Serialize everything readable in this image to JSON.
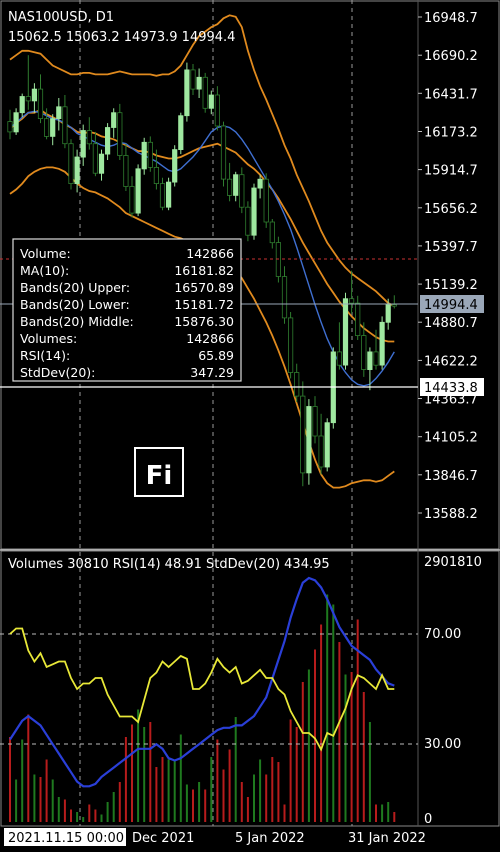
{
  "header": {
    "symbol": "NAS100USD, D1",
    "ohlc": "15062.5 15063.2 14973.9 14994.4"
  },
  "price_axis": {
    "labels": [
      "16948.7",
      "16690.2",
      "16431.7",
      "16173.2",
      "15914.7",
      "15656.2",
      "15397.7",
      "15139.2",
      "14880.7",
      "14622.2",
      "14363.7",
      "14105.2",
      "13846.7",
      "13588.2"
    ],
    "current_price": "14994.4",
    "crosshair_price": "14433.8"
  },
  "data_window": {
    "rows": [
      {
        "label": "Volume:",
        "value": "142866"
      },
      {
        "label": "MA(10):",
        "value": "16181.82"
      },
      {
        "label": "Bands(20) Upper:",
        "value": "16570.89"
      },
      {
        "label": "Bands(20) Lower:",
        "value": "15181.72"
      },
      {
        "label": "Bands(20) Middle:",
        "value": "15876.30"
      },
      {
        "label": "Volumes:",
        "value": "142866"
      },
      {
        "label": "RSI(14):",
        "value": "65.89"
      },
      {
        "label": "StdDev(20):",
        "value": "347.29"
      }
    ]
  },
  "logo": {
    "text": "Fi"
  },
  "subwindow": {
    "title": "Volumes 30810 RSI(14) 48.91 StdDev(20) 434.95",
    "labels": [
      "2901810",
      "70.00",
      "30.00",
      "0"
    ]
  },
  "time_axis": {
    "labels": [
      "2021.11.15 00:00",
      "Dec 2021",
      "5 Jan 2022",
      "31 Jan 2022"
    ]
  },
  "colors": {
    "bull_candle": "#9fe8a0",
    "bear_candle": "#2f7d2f",
    "bands": "#e08a1e",
    "ma": "#3f6fd1",
    "rsi": "#e8e838",
    "stddev": "#2a3fd8",
    "vol_up": "#1f7a1f",
    "vol_down": "#b81c1c",
    "red_level": "#c83232"
  },
  "chart_data": {
    "type": "candlestick",
    "ohlc": [
      [
        16240,
        16320,
        16120,
        16170
      ],
      [
        16170,
        16330,
        16150,
        16300
      ],
      [
        16300,
        16430,
        16270,
        16410
      ],
      [
        16410,
        16690,
        16320,
        16380
      ],
      [
        16380,
        16500,
        16300,
        16460
      ],
      [
        16460,
        16560,
        16230,
        16260
      ],
      [
        16260,
        16330,
        16120,
        16140
      ],
      [
        16140,
        16290,
        16080,
        16260
      ],
      [
        16260,
        16400,
        16180,
        16340
      ],
      [
        16340,
        16420,
        16060,
        16090
      ],
      [
        16090,
        16120,
        15780,
        15820
      ],
      [
        15820,
        16050,
        15760,
        16000
      ],
      [
        16000,
        16220,
        15940,
        16180
      ],
      [
        16180,
        16270,
        16050,
        16090
      ],
      [
        16090,
        16170,
        15870,
        15890
      ],
      [
        15890,
        16050,
        15840,
        16020
      ],
      [
        16020,
        16230,
        15980,
        16200
      ],
      [
        16200,
        16330,
        16130,
        16300
      ],
      [
        16300,
        16360,
        15980,
        16010
      ],
      [
        16010,
        16090,
        15770,
        15800
      ],
      [
        15800,
        15870,
        15590,
        15620
      ],
      [
        15620,
        15950,
        15600,
        15920
      ],
      [
        15920,
        16130,
        15880,
        16100
      ],
      [
        16100,
        16140,
        15900,
        15930
      ],
      [
        15930,
        16050,
        15780,
        15820
      ],
      [
        15820,
        15860,
        15640,
        15660
      ],
      [
        15660,
        15860,
        15640,
        15830
      ],
      [
        15830,
        16080,
        15800,
        16050
      ],
      [
        16050,
        16300,
        16020,
        16280
      ],
      [
        16280,
        16640,
        16240,
        16590
      ],
      [
        16590,
        16630,
        16420,
        16460
      ],
      [
        16460,
        16600,
        16400,
        16540
      ],
      [
        16540,
        16570,
        16300,
        16330
      ],
      [
        16330,
        16450,
        16290,
        16420
      ],
      [
        16420,
        16480,
        16180,
        16210
      ],
      [
        16210,
        16240,
        15800,
        15850
      ],
      [
        15850,
        15960,
        15700,
        15740
      ],
      [
        15740,
        15900,
        15700,
        15880
      ],
      [
        15880,
        15930,
        15620,
        15660
      ],
      [
        15660,
        15700,
        15430,
        15470
      ],
      [
        15470,
        15820,
        15440,
        15790
      ],
      [
        15790,
        15880,
        15720,
        15850
      ],
      [
        15850,
        15890,
        15520,
        15560
      ],
      [
        15560,
        15580,
        15380,
        15420
      ],
      [
        15420,
        15460,
        15150,
        15190
      ],
      [
        15190,
        15260,
        14870,
        14910
      ],
      [
        14910,
        14950,
        14500,
        14540
      ],
      [
        14540,
        14600,
        14340,
        14380
      ],
      [
        14380,
        14480,
        13770,
        13860
      ],
      [
        13860,
        14360,
        13780,
        14310
      ],
      [
        14310,
        14380,
        14060,
        14110
      ],
      [
        14110,
        14260,
        13850,
        13900
      ],
      [
        13900,
        14230,
        13870,
        14200
      ],
      [
        14200,
        14710,
        14160,
        14680
      ],
      [
        14680,
        14880,
        14560,
        14590
      ],
      [
        14590,
        15080,
        14560,
        15040
      ],
      [
        15040,
        15230,
        14940,
        15010
      ],
      [
        15010,
        15060,
        14760,
        14790
      ],
      [
        14790,
        14880,
        14510,
        14560
      ],
      [
        14560,
        14710,
        14420,
        14680
      ],
      [
        14680,
        14830,
        14560,
        14590
      ],
      [
        14590,
        14920,
        14560,
        14880
      ],
      [
        14880,
        15040,
        14830,
        15000
      ],
      [
        15000,
        15063,
        14974,
        14994
      ]
    ],
    "ylim": [
      13500,
      17000
    ],
    "price_ticks": [
      16948.7,
      16690.2,
      16431.7,
      16173.2,
      15914.7,
      15656.2,
      15397.7,
      15139.2,
      14880.7,
      14622.2,
      14363.7,
      14105.2,
      13846.7,
      13588.2
    ],
    "bands_upper": [
      16660,
      16690,
      16720,
      16720,
      16710,
      16700,
      16660,
      16620,
      16600,
      16580,
      16560,
      16560,
      16570,
      16570,
      16560,
      16560,
      16560,
      16570,
      16580,
      16570,
      16560,
      16560,
      16560,
      16560,
      16550,
      16560,
      16560,
      16580,
      16620,
      16690,
      16760,
      16820,
      16850,
      16880,
      16900,
      16940,
      16960,
      16950,
      16880,
      16720,
      16590,
      16480,
      16390,
      16290,
      16190,
      16080,
      15990,
      15880,
      15790,
      15700,
      15600,
      15500,
      15420,
      15360,
      15300,
      15250,
      15210,
      15180,
      15150,
      15120,
      15090,
      15050,
      15010,
      14990
    ],
    "bands_middle": [
      16190,
      16230,
      16260,
      16300,
      16300,
      16320,
      16290,
      16270,
      16250,
      16220,
      16200,
      16170,
      16160,
      16170,
      16160,
      16140,
      16130,
      16120,
      16100,
      16080,
      16060,
      16040,
      16040,
      16030,
      16010,
      16000,
      15990,
      15990,
      16000,
      16020,
      16040,
      16060,
      16070,
      16080,
      16090,
      16070,
      16050,
      16030,
      15990,
      15950,
      15920,
      15880,
      15830,
      15780,
      15720,
      15650,
      15580,
      15500,
      15420,
      15350,
      15280,
      15210,
      15140,
      15080,
      15020,
      14970,
      14920,
      14880,
      14840,
      14810,
      14780,
      14760,
      14750,
      14750
    ],
    "bands_lower": [
      15750,
      15780,
      15820,
      15870,
      15900,
      15920,
      15930,
      15930,
      15920,
      15900,
      15860,
      15820,
      15790,
      15770,
      15760,
      15740,
      15720,
      15690,
      15660,
      15620,
      15600,
      15580,
      15560,
      15540,
      15520,
      15500,
      15480,
      15460,
      15450,
      15430,
      15410,
      15390,
      15370,
      15350,
      15330,
      15300,
      15270,
      15230,
      15180,
      15110,
      15040,
      14960,
      14880,
      14790,
      14690,
      14580,
      14460,
      14330,
      14200,
      14070,
      13950,
      13850,
      13790,
      13760,
      13760,
      13770,
      13790,
      13800,
      13810,
      13810,
      13800,
      13810,
      13840,
      13870
    ],
    "ma10": [
      16200,
      16230,
      16270,
      16300,
      16310,
      16300,
      16280,
      16260,
      16250,
      16230,
      16200,
      16160,
      16140,
      16120,
      16100,
      16080,
      16070,
      16080,
      16100,
      16090,
      16060,
      16030,
      16010,
      15990,
      15970,
      15940,
      15910,
      15900,
      15920,
      15960,
      16000,
      16050,
      16110,
      16170,
      16200,
      16210,
      16200,
      16170,
      16120,
      16060,
      15990,
      15920,
      15850,
      15780,
      15700,
      15610,
      15510,
      15390,
      15260,
      15130,
      15000,
      14880,
      14770,
      14680,
      14600,
      14540,
      14490,
      14460,
      14450,
      14460,
      14500,
      14550,
      14610,
      14680
    ],
    "volume_scale": [
      0,
      2901810
    ],
    "volumes": [
      0.34,
      0.17,
      0.33,
      0.43,
      0.19,
      0.18,
      0.25,
      0.17,
      0.1,
      0.09,
      0.05,
      0.04,
      0.02,
      0.07,
      0.05,
      0.03,
      0.08,
      0.12,
      0.16,
      0.34,
      0.39,
      0.45,
      0.38,
      0.4,
      0.22,
      0.26,
      0.25,
      0.25,
      0.35,
      0.15,
      0.13,
      0.16,
      0.13,
      0.26,
      0.33,
      0.21,
      0.29,
      0.42,
      0.16,
      0.1,
      0.19,
      0.25,
      0.19,
      0.26,
      0.24,
      0.07,
      0.41,
      0.38,
      0.56,
      0.61,
      0.69,
      0.79,
      0.91,
      0.87,
      0.72,
      0.59,
      0.6,
      0.81,
      0.52,
      0.4,
      0.07,
      0.07,
      0.08,
      0.04
    ],
    "rsi_ticks": [
      70,
      30
    ],
    "rsi": [
      70,
      72,
      72,
      64,
      60,
      63,
      58,
      59,
      60,
      60,
      54,
      50,
      52,
      52,
      54,
      54,
      48,
      44,
      40,
      40,
      40,
      38,
      46,
      54,
      56,
      60,
      58,
      60,
      62,
      61,
      50,
      50,
      52,
      56,
      61,
      58,
      56,
      58,
      52,
      53,
      55,
      57,
      54,
      54,
      50,
      48,
      42,
      38,
      34,
      34,
      32,
      28,
      34,
      33,
      38,
      43,
      50,
      55,
      54,
      52,
      50,
      55,
      50,
      50
    ],
    "stddev": [
      28,
      32,
      36,
      38,
      36,
      34,
      30,
      26,
      22,
      18,
      14,
      10,
      8,
      8,
      9,
      12,
      14,
      16,
      18,
      20,
      22,
      24,
      24,
      24,
      26,
      24,
      20,
      19,
      20,
      22,
      24,
      26,
      28,
      30,
      32,
      33,
      33,
      34,
      34,
      36,
      38,
      42,
      46,
      54,
      62,
      70,
      80,
      88,
      95,
      97,
      96,
      93,
      88,
      82,
      76,
      72,
      68,
      66,
      64,
      62,
      58,
      55,
      52,
      51
    ]
  }
}
